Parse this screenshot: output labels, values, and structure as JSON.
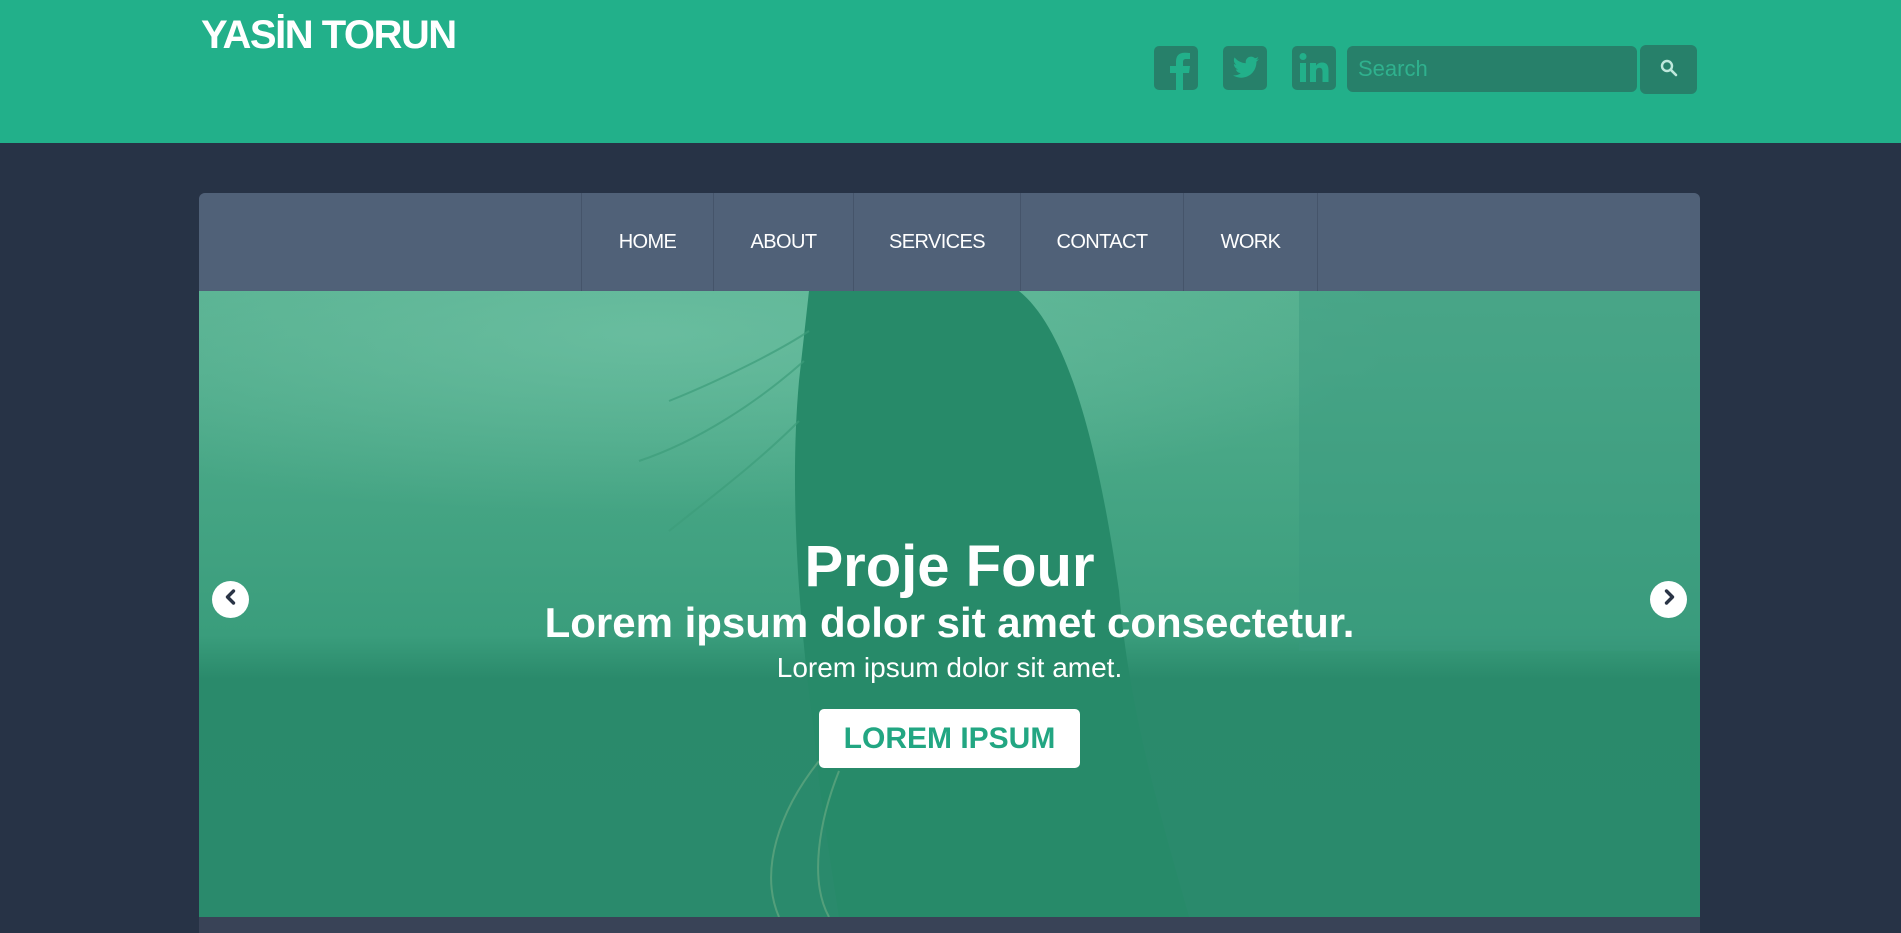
{
  "header": {
    "brand": "YASİN TORUN",
    "social": [
      "facebook-icon",
      "twitter-icon",
      "linkedin-icon"
    ],
    "search": {
      "placeholder": "Search",
      "value": ""
    },
    "colors": {
      "background": "#22b08a",
      "icon": "#27806a"
    }
  },
  "nav": {
    "items": [
      {
        "label": "HOME"
      },
      {
        "label": "ABOUT"
      },
      {
        "label": "SERVICES"
      },
      {
        "label": "CONTACT"
      },
      {
        "label": "WORK"
      }
    ]
  },
  "slider": {
    "title": "Proje Four",
    "subtitle": "Lorem ipsum dolor sit amet consectetur.",
    "text": "Lorem ipsum dolor sit amet.",
    "button": "LOREM IPSUM",
    "prev_icon": "chevron-left-icon",
    "next_icon": "chevron-right-icon",
    "overlay_color": "#22b08a"
  },
  "page": {
    "background": "#273346",
    "nav_background": "#506178"
  }
}
